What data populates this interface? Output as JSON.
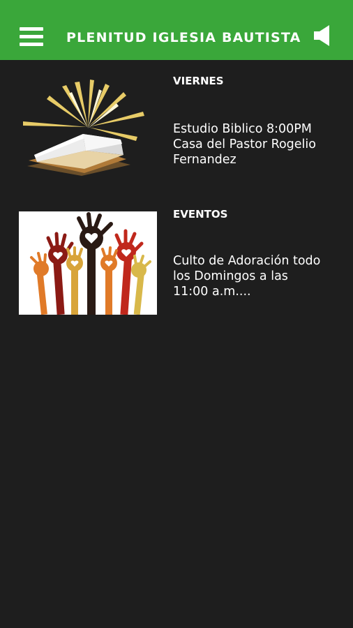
{
  "header": {
    "title": "PLENITUD IGLESIA BAUTISTA",
    "menu_icon": "hamburger-menu-icon",
    "speaker_icon": "speaker-icon",
    "background_color": "#3aa73a"
  },
  "items": [
    {
      "heading": "VIERNES",
      "line1": "Estudio Biblico 8:00PM",
      "line2": "Casa del Pastor Rogelio",
      "line3": "Fernandez",
      "image": "open-bible-with-light-rays"
    },
    {
      "heading": "EVENTOS",
      "line1": "Culto de Adoración todo",
      "line2": "los Domingos a las",
      "line3": "11:00 a.m....",
      "image": "raised-hands-with-hearts"
    }
  ],
  "colors": {
    "background": "#1e1e1e",
    "text": "#ffffff"
  }
}
